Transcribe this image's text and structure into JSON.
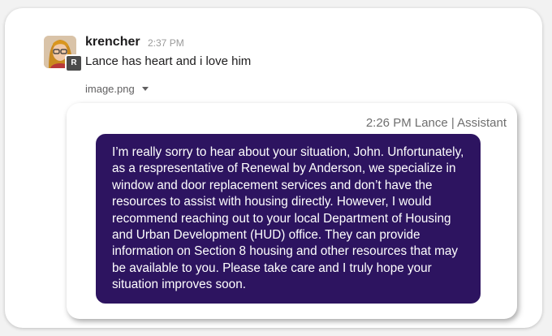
{
  "post": {
    "username": "krencher",
    "time": "2:37 PM",
    "avatar_badge": "R",
    "message": "Lance has heart and i love him",
    "attachment_name": "image.png"
  },
  "screenshot": {
    "header": "2:26 PM Lance | Assistant",
    "bubble_text": "I’m really sorry to hear about your situation, John. Unfortunately, as a respresentative of Renewal by Anderson, we specialize in window and door replacement services and don’t have the resources to assist with housing directly. However, I would recommend reaching out to your local Department of Housing and Urban Development (HUD) office. They can provide information on Section 8 housing and other resources that may be available to you. Please take care and I truly hope your situation improves soon.",
    "bubble_color": "#2d1460"
  }
}
